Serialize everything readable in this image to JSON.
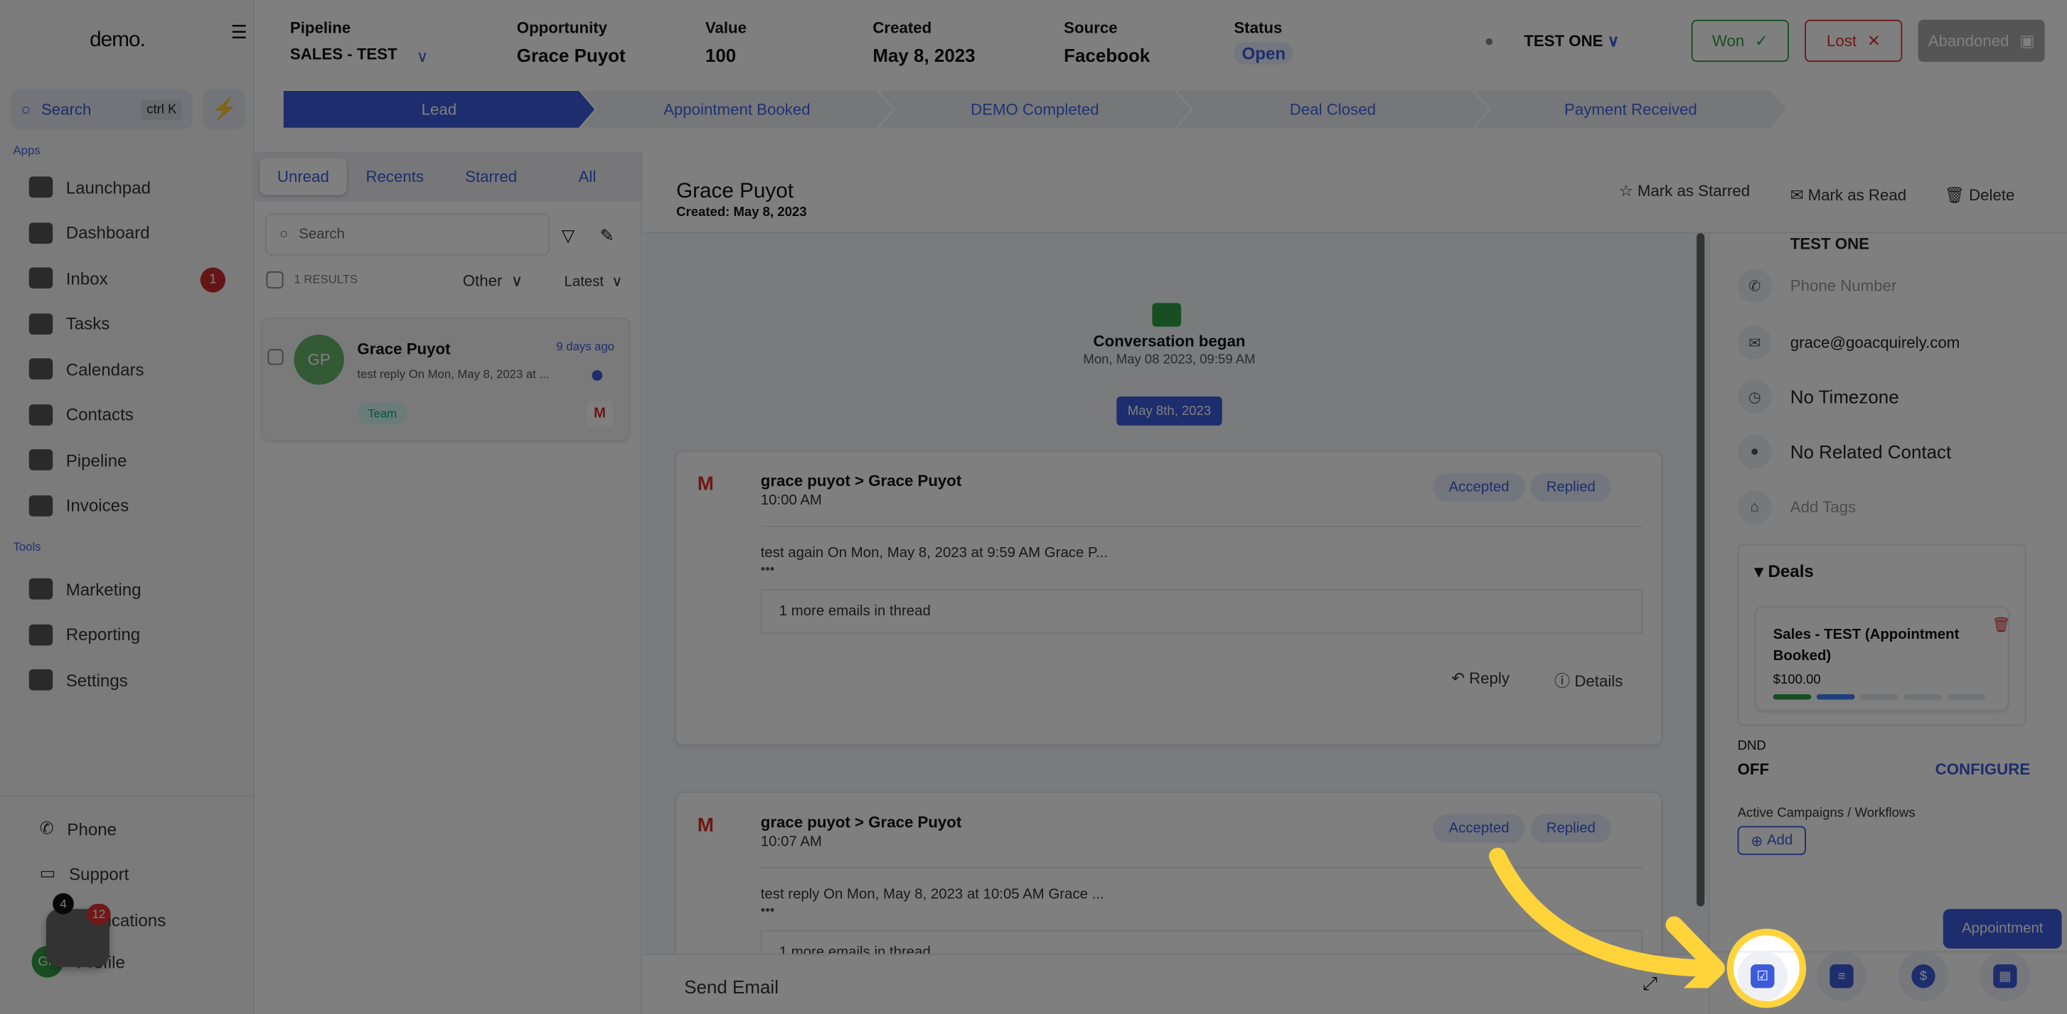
{
  "sidebar": {
    "logo": "demo.",
    "search": "Search",
    "shortcut": "ctrl K",
    "apps_label": "Apps",
    "tools_label": "Tools",
    "apps": [
      {
        "label": "Launchpad",
        "icon": "rocket-icon"
      },
      {
        "label": "Dashboard",
        "icon": "grid-icon"
      },
      {
        "label": "Inbox",
        "icon": "inbox-icon",
        "badge": "1"
      },
      {
        "label": "Tasks",
        "icon": "clipboard-icon"
      },
      {
        "label": "Calendars",
        "icon": "calendar-icon"
      },
      {
        "label": "Contacts",
        "icon": "user-icon"
      },
      {
        "label": "Pipeline",
        "icon": "filter-icon"
      },
      {
        "label": "Invoices",
        "icon": "invoice-icon"
      }
    ],
    "tools": [
      {
        "label": "Marketing",
        "icon": "megaphone-icon"
      },
      {
        "label": "Reporting",
        "icon": "pie-icon"
      },
      {
        "label": "Settings",
        "icon": "gear-icon"
      }
    ],
    "bottom": [
      {
        "label": "Phone"
      },
      {
        "label": "Support"
      },
      {
        "label": "Notifications"
      },
      {
        "label": "Profile"
      }
    ],
    "chat_badge": "12",
    "notif_badge": "4",
    "avatar": "GP"
  },
  "header": {
    "fields": [
      {
        "label": "Pipeline",
        "value": "SALES - TEST"
      },
      {
        "label": "Opportunity",
        "value": "Grace Puyot"
      },
      {
        "label": "Value",
        "value": "100"
      },
      {
        "label": "Created",
        "value": "May 8, 2023"
      },
      {
        "label": "Source",
        "value": "Facebook"
      },
      {
        "label": "Status",
        "value": "Open"
      }
    ],
    "user": "TEST ONE",
    "won": "Won",
    "lost": "Lost",
    "abandoned": "Abandoned"
  },
  "stages": [
    "Lead",
    "Appointment Booked",
    "DEMO Completed",
    "Deal Closed",
    "Payment Received"
  ],
  "list": {
    "tabs": [
      "Unread",
      "Recents",
      "Starred",
      "All"
    ],
    "search_placeholder": "Search",
    "results": "1 RESULTS",
    "filter1": "Other",
    "filter2": "Latest",
    "item": {
      "initials": "GP",
      "name": "Grace Puyot",
      "time": "9 days ago",
      "preview": "test reply On Mon, May 8, 2023 at ...",
      "tag": "Team"
    }
  },
  "conversation": {
    "name": "Grace Puyot",
    "created": "Created: May 8, 2023",
    "star": "Mark as Starred",
    "read": "Mark as Read",
    "delete": "Delete",
    "began": "Conversation began",
    "began_time": "Mon, May 08 2023, 09:59 AM",
    "date_chip": "May 8th, 2023",
    "emails": [
      {
        "from": "grace puyot",
        "to": "Grace Puyot",
        "time": "10:00 AM",
        "body": "test again On Mon, May 8, 2023 at 9:59 AM Grace P...",
        "more": "1 more emails in thread",
        "s1": "Accepted",
        "s2": "Replied"
      },
      {
        "from": "grace puyot",
        "to": "Grace Puyot",
        "time": "10:07 AM",
        "body": "test reply On Mon, May 8, 2023 at 10:05 AM Grace ...",
        "more": "1 more emails in thread",
        "s1": "Accepted",
        "s2": "Replied"
      }
    ],
    "reply": "Reply",
    "details": "Details",
    "composer": "Send Email"
  },
  "contact": {
    "owner": "TEST ONE",
    "phone_placeholder": "Phone Number",
    "email": "grace@goacquirely.com",
    "timezone": "No Timezone",
    "related": "No Related Contact",
    "tags_placeholder": "Add Tags",
    "deals_label": "Deals",
    "deal_name": "Sales - TEST (Appointment Booked)",
    "deal_value": "$100.00",
    "deal_progress": "2 of 5",
    "dnd_label": "DND",
    "dnd_value": "OFF",
    "configure": "CONFIGURE",
    "campaigns_label": "Active Campaigns / Workflows",
    "add": "Add",
    "appointment": "Appointment"
  },
  "colors": {
    "accent": "#3b5bdb",
    "highlight": "#ffd43b",
    "won": "#2f9e44",
    "lost": "#e03131"
  }
}
